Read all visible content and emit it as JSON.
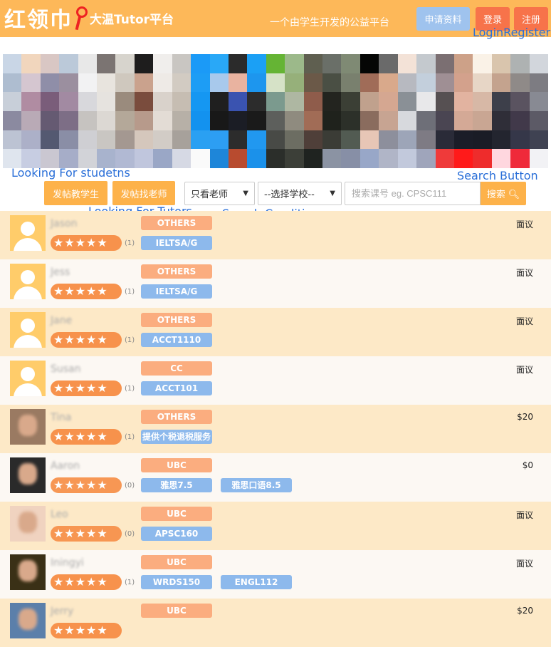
{
  "header": {
    "logo_cn": "红领巾",
    "logo_sub": "大温Tutor平台",
    "slogan": "一个由学生开发的公益平台",
    "apply_label": "申请资料",
    "login_label": "登录",
    "register_label": "注册"
  },
  "annotations": {
    "login_register": "LoginRegister",
    "looking_students": "Looking For studetns",
    "search_button": "Search Button",
    "looking_tutors": "Looking For Tutors",
    "search_condition": "Search Condition"
  },
  "toolbar": {
    "post_teach_label": "发帖教学生",
    "post_find_label": "发帖找老师",
    "filter_role": "只看老师",
    "filter_school": "--选择学校--",
    "search_placeholder": "搜索课号 eg. CPSC111",
    "search_label": "搜索"
  },
  "colors": {
    "header_bg": "#fdb859",
    "accent_orange": "#fdb24a",
    "login_red": "#f7734a",
    "apply_blue": "#9fc3ee",
    "course_tag_blue": "#8db9ec",
    "school_tag_orange": "#fbad7f",
    "row_highlight": "#fde9c7"
  },
  "tutors": [
    {
      "name": "Jason",
      "stars": "★★★★★",
      "count": "(1)",
      "school": "OTHERS",
      "courses": [
        "IELTSA/G"
      ],
      "price": "面议"
    },
    {
      "name": "Jess",
      "stars": "★★★★★",
      "count": "(1)",
      "school": "OTHERS",
      "courses": [
        "IELTSA/G"
      ],
      "price": "面议"
    },
    {
      "name": "Jane",
      "stars": "★★★★★",
      "count": "(1)",
      "school": "OTHERS",
      "courses": [
        "ACCT1110"
      ],
      "price": "面议"
    },
    {
      "name": "Susan",
      "stars": "★★★★★",
      "count": "(1)",
      "school": "CC",
      "courses": [
        "ACCT101"
      ],
      "price": "面议"
    },
    {
      "name": "Tina",
      "stars": "★★★★★",
      "count": "(1)",
      "school": "OTHERS",
      "courses": [
        "提供个税退税服务"
      ],
      "price": "$20"
    },
    {
      "name": "Aaron",
      "stars": "★★★★★",
      "count": "(0)",
      "school": "UBC",
      "courses": [
        "雅思7.5",
        "雅思口语8.5"
      ],
      "price": "$0"
    },
    {
      "name": "Leo",
      "stars": "★★★★★",
      "count": "(0)",
      "school": "UBC",
      "courses": [
        "APSC160"
      ],
      "price": "面议"
    },
    {
      "name": "Iningyi",
      "stars": "★★★★★",
      "count": "(1)",
      "school": "UBC",
      "courses": [
        "WRDS150",
        "ENGL112"
      ],
      "price": "面议"
    },
    {
      "name": "Jerry",
      "stars": "★★★★★",
      "count": "",
      "school": "UBC",
      "courses": [],
      "price": "$20"
    }
  ]
}
